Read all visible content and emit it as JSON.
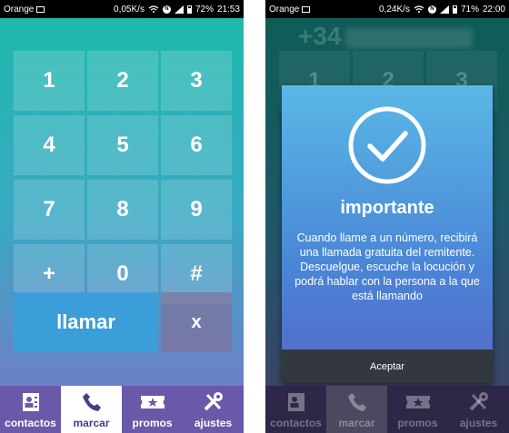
{
  "left": {
    "status": {
      "carrier": "Orange",
      "speed": "0,05K/s",
      "battery": "72%",
      "time": "21:53"
    },
    "keys": [
      "1",
      "2",
      "3",
      "4",
      "5",
      "6",
      "7",
      "8",
      "9",
      "+",
      "0",
      "#"
    ],
    "call_label": "llamar",
    "clear_label": "x",
    "tabs": [
      {
        "label": "contactos",
        "icon": "contacts-icon"
      },
      {
        "label": "marcar",
        "icon": "phone-icon"
      },
      {
        "label": "promos",
        "icon": "ticket-icon"
      },
      {
        "label": "ajustes",
        "icon": "settings-icon"
      }
    ]
  },
  "right": {
    "status": {
      "carrier": "Orange",
      "speed": "0,24K/s",
      "battery": "71%",
      "time": "22:00"
    },
    "number_prefix": "+34",
    "keys": [
      "1",
      "2",
      "3"
    ],
    "dialog": {
      "title": "importante",
      "body": "Cuando llame a un número, recibirá una llamada gratuita del remitente. Descuelgue, escuche la locución y podrá hablar con la persona a la que está llamando",
      "accept_label": "Aceptar"
    },
    "tabs": [
      {
        "label": "contactos",
        "icon": "contacts-icon"
      },
      {
        "label": "marcar",
        "icon": "phone-icon"
      },
      {
        "label": "promos",
        "icon": "ticket-icon"
      },
      {
        "label": "ajustes",
        "icon": "settings-icon"
      }
    ]
  },
  "colors": {
    "accent": "#3b9ed8",
    "tabbar": "#6a58a8",
    "teal": "#1fb9ad"
  }
}
